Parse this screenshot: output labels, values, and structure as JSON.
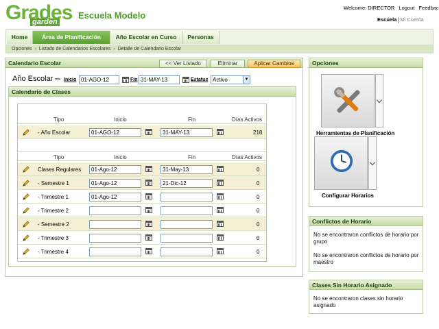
{
  "header": {
    "logo_main": "Grades",
    "logo_sub": "garden",
    "school_name": "Escuela Modelo",
    "welcome": "Welcome: DIRECTOR",
    "logout": "Logout",
    "feedback": "Feedback",
    "user_menu": [
      "Escuela",
      "Mi Cuenta"
    ]
  },
  "nav": {
    "tabs": [
      "Home",
      "Área de Planificación",
      "Año Escolar en Curso",
      "Personas"
    ],
    "active_tab": "Área de Planificación",
    "breadcrumb": [
      "Opciones",
      "Listado de Calendarios Escolares",
      "Detalle de Calendario Escolar"
    ]
  },
  "calendar_panel": {
    "title": "Calendario Escolar",
    "buttons": {
      "back": "<< Ver Listado",
      "delete": "Eliminar",
      "apply": "Aplicar Cambios"
    },
    "year_label": "Año Escolar",
    "arrow": "=>",
    "start_label": "Inicio",
    "start_value": "01-AGO-12",
    "end_label": "Fin",
    "end_value": "31-MAY-13",
    "status_label": "Estatus",
    "status_value": "Activo"
  },
  "classes_panel": {
    "title": "Calendario de Clases",
    "columns": [
      "Tipo",
      "Inicio",
      "Fin",
      "Días Activos"
    ],
    "year_row": {
      "type": "- Año Escolar",
      "start": "01-AGO-12",
      "end": "31-MAY-13",
      "days": "218"
    },
    "rows": [
      {
        "type": "Clases Regulares",
        "start": "01-Ago-12",
        "end": "31-May-13",
        "days": "0"
      },
      {
        "type": "- Semestre 1",
        "start": "01-Ago-12",
        "end": "21-Dic-12",
        "days": "0"
      },
      {
        "type": "- Trimestre 1",
        "start": "01-Ago-12",
        "end": "",
        "days": "0"
      },
      {
        "type": "- Trimestre 2",
        "start": "",
        "end": "",
        "days": "0"
      },
      {
        "type": "- Semestre 2",
        "start": "",
        "end": "",
        "days": "0"
      },
      {
        "type": "- Trimestre 3",
        "start": "",
        "end": "",
        "days": "0"
      },
      {
        "type": "- Trimestre 4",
        "start": "",
        "end": "",
        "days": "0"
      }
    ]
  },
  "options_panel": {
    "title": "Opciones",
    "items": [
      {
        "label": "Herramientas de Planificación",
        "icon": "tools-icon"
      },
      {
        "label": "Configurar Horarios",
        "icon": "clock-icon"
      }
    ]
  },
  "conflicts_panel": {
    "title": "Conflictos de Horario",
    "messages": [
      "No se encontraron conflictos de horario por grupo",
      "No se encontraron conflictos de horario por maestro"
    ]
  },
  "unassigned_panel": {
    "title": "Clases Sin Horario Asignado",
    "message": "No se encontraron clases sin horario asignado"
  },
  "colors": {
    "brand_green": "#5ca232",
    "apply_orange": "#f7c35c",
    "shaded_row": "#f5f0d4"
  }
}
